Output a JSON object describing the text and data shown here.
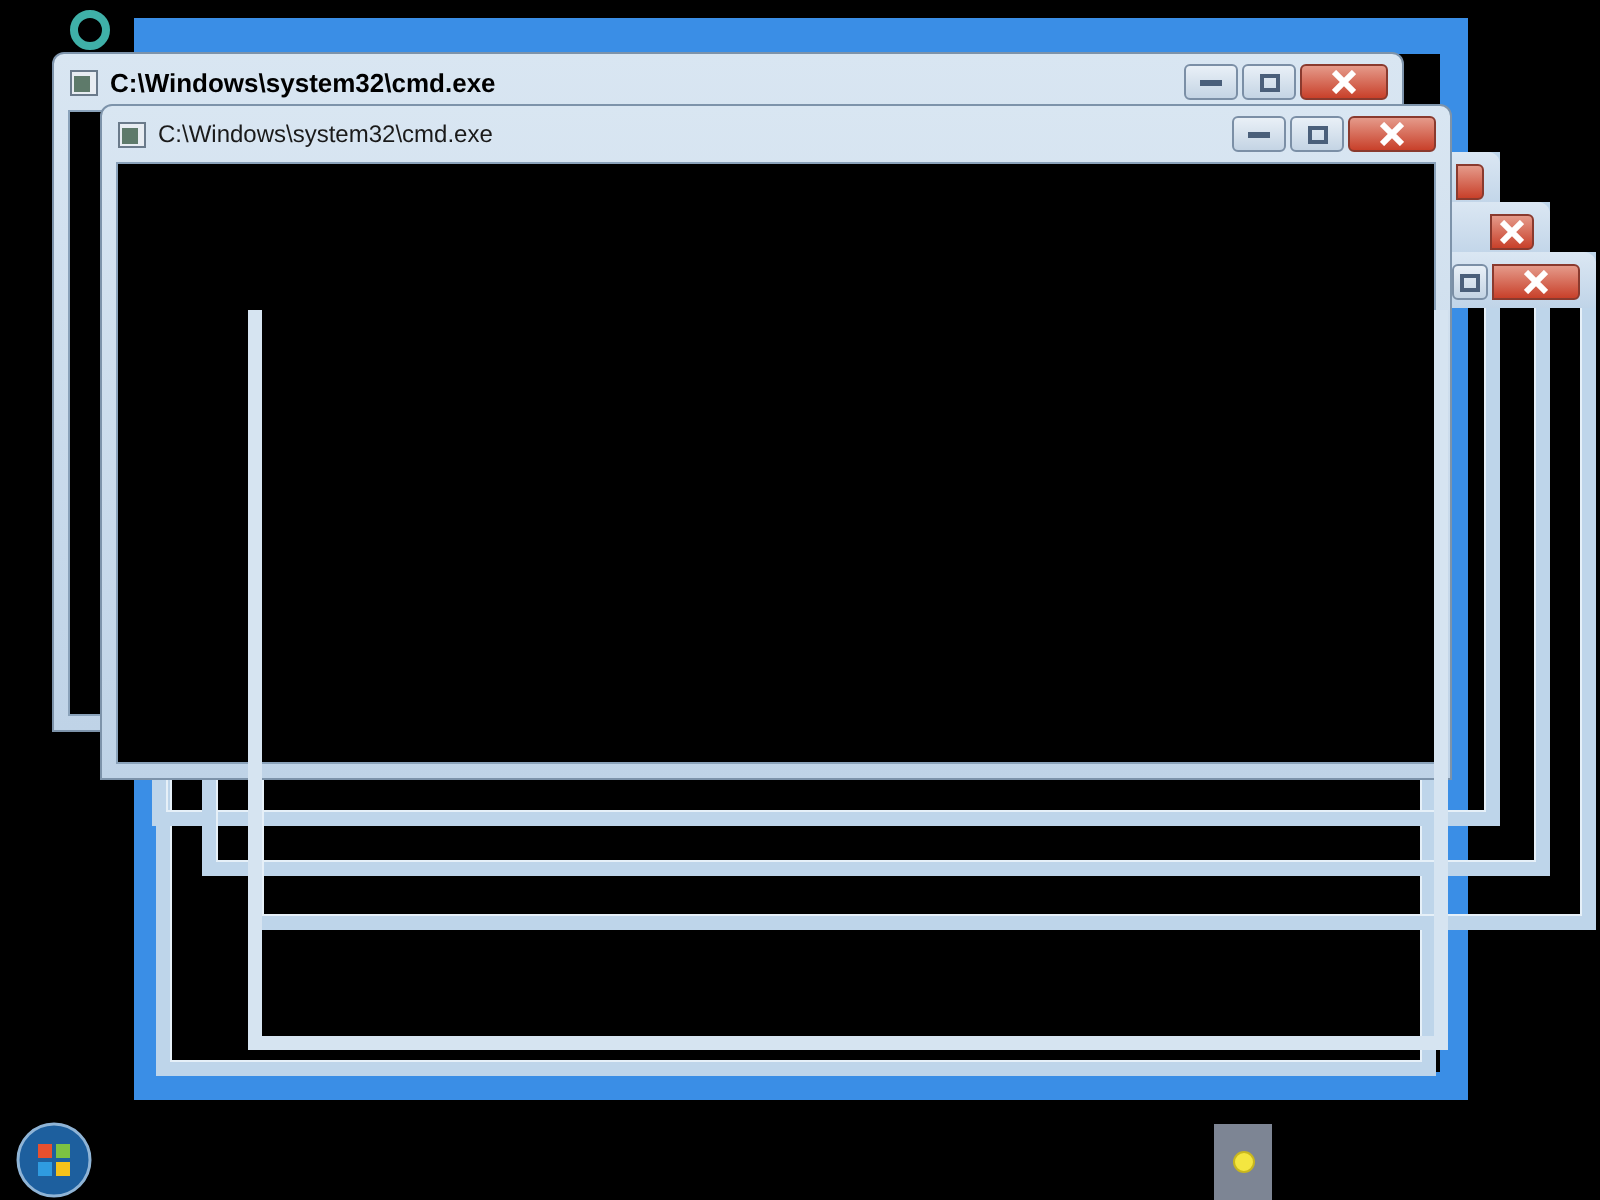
{
  "windows": [
    {
      "title": "C:\\Windows\\system32\\cmd.exe",
      "bold": true
    },
    {
      "title": "C:\\Windows\\system32\\cmd.exe",
      "bold": false
    }
  ]
}
